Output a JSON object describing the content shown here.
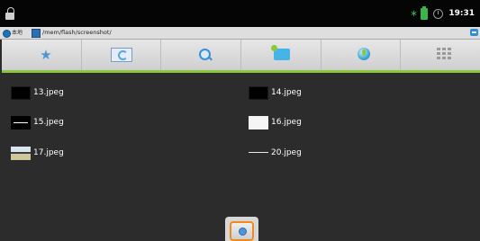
{
  "status_bar": {
    "time": "19:31"
  },
  "path_bar": {
    "location_label": "本地",
    "path": "/mem/flash/screenshot/"
  },
  "toolbar": {
    "buttons": [
      {
        "name": "favorites",
        "icon": "star-icon"
      },
      {
        "name": "refresh",
        "icon": "refresh-icon"
      },
      {
        "name": "search",
        "icon": "search-icon"
      },
      {
        "name": "new-folder",
        "icon": "new-folder-icon"
      },
      {
        "name": "network",
        "icon": "globe-icon"
      },
      {
        "name": "view-mode",
        "icon": "grid-icon"
      }
    ],
    "accent_color": "#8cc63f"
  },
  "files": [
    {
      "name": "13.jpeg"
    },
    {
      "name": "14.jpeg"
    },
    {
      "name": "15.jpeg"
    },
    {
      "name": "16.jpeg"
    },
    {
      "name": "17.jpeg"
    },
    {
      "name": "20.jpeg"
    }
  ]
}
